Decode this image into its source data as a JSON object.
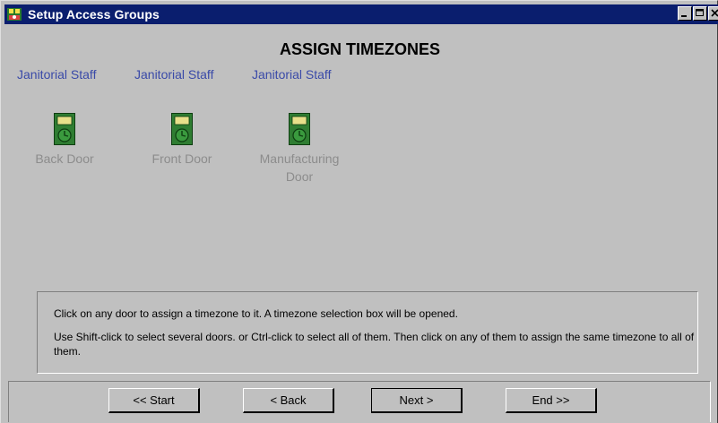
{
  "window": {
    "title": "Setup Access Groups"
  },
  "page": {
    "heading": "ASSIGN TIMEZONES"
  },
  "groups": [
    {
      "label": "Janitorial Staff"
    },
    {
      "label": "Janitorial Staff"
    },
    {
      "label": "Janitorial Staff"
    }
  ],
  "doors": [
    {
      "label_line1": "Back Door",
      "label_line2": "",
      "icon": "door-timeclock-icon"
    },
    {
      "label_line1": "Front Door",
      "label_line2": "",
      "icon": "door-timeclock-icon"
    },
    {
      "label_line1": "Manufacturing",
      "label_line2": "Door",
      "icon": "door-timeclock-icon"
    }
  ],
  "instructions": {
    "line1": "Click on any door to assign a timezone to it.  A timezone selection box will be opened.",
    "line2": "Use Shift-click to select several doors. or Ctrl-click to select all of them.  Then click on any of them to assign the same timezone to all of them."
  },
  "buttons": {
    "start": "<< Start",
    "back": "< Back",
    "next": "Next >",
    "end": "End >>"
  },
  "colors": {
    "titlebar": "#0a1e6e",
    "group_label": "#3a4aa8",
    "door_label_disabled": "#8c8c8c",
    "icon_green": "#2f7d32",
    "icon_yellow": "#e8e08a"
  }
}
